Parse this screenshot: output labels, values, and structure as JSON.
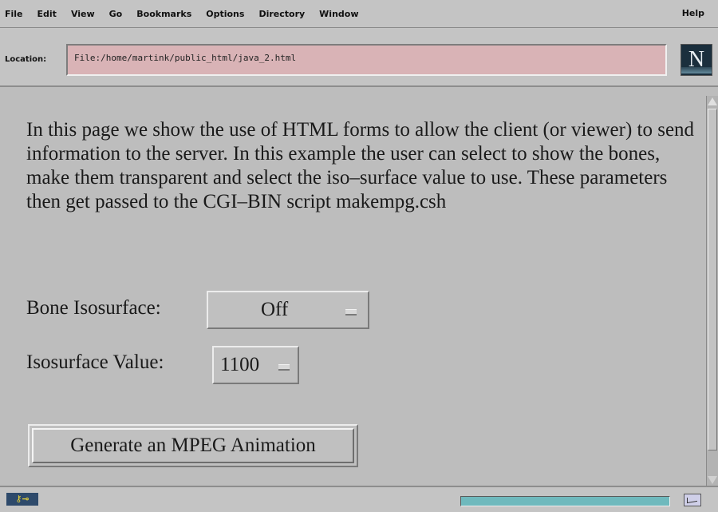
{
  "menubar": {
    "items": [
      "File",
      "Edit",
      "View",
      "Go",
      "Bookmarks",
      "Options",
      "Directory",
      "Window"
    ],
    "help": "Help"
  },
  "location": {
    "label": "Location:",
    "url": "File:/home/martink/public_html/java_2.html",
    "logo": "N"
  },
  "content": {
    "paragraph": "In this page we show the use of HTML forms to allow the client (or viewer) to send information to the server. In this example the user can select to show the bones, make them transparent and select the iso–surface value to use. These parameters then get passed to the CGI–BIN script makempg.csh",
    "bone_label": "Bone Isosurface:",
    "bone_value": "Off",
    "iso_label": "Isosurface Value:",
    "iso_value": "1100",
    "button_label": "Generate an MPEG Animation"
  },
  "status": {
    "security_icon": "key-icon",
    "mail_icon": "mail-icon"
  }
}
